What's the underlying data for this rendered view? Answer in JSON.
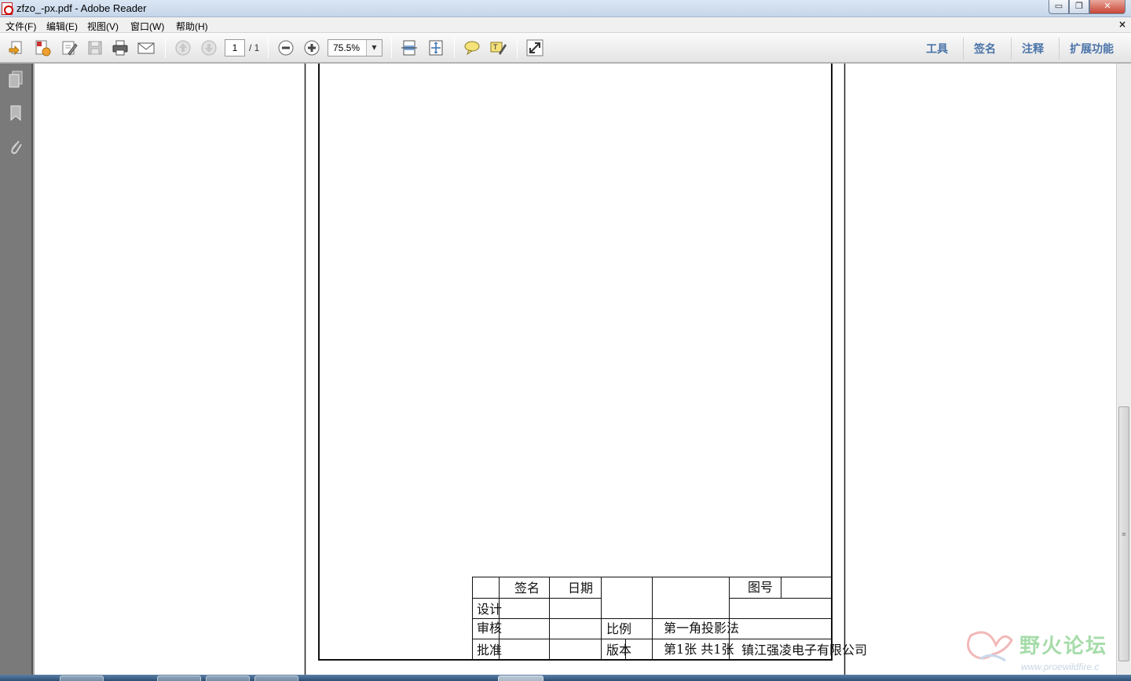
{
  "window": {
    "title": "zfzo_-px.pdf - Adobe Reader",
    "min_glyph": "▭",
    "max_glyph": "❐",
    "close_glyph": "✕"
  },
  "menu": {
    "items": [
      "文件(F)",
      "编辑(E)",
      "视图(V)",
      "窗口(W)",
      "帮助(H)"
    ],
    "close_glyph": "×"
  },
  "toolbar": {
    "page_number": "1",
    "page_total": "/ 1",
    "zoom": "75.5%",
    "zoom_arrow": "▼",
    "tabs": [
      "工具",
      "签名",
      "注释",
      "扩展功能"
    ]
  },
  "title_block": {
    "sign_header": "签名",
    "date_header": "日期",
    "drawing_no_label": "图号",
    "design": "设计",
    "review": "审核",
    "approve": "批准",
    "scale_label": "比例",
    "version_label": "版本",
    "projection": "第一角投影法",
    "sheet_info": "第1张  共1张",
    "company": "镇江强凌电子有限公司"
  },
  "watermark": {
    "text": "野火论坛",
    "url": "www.proewildfire.c"
  }
}
